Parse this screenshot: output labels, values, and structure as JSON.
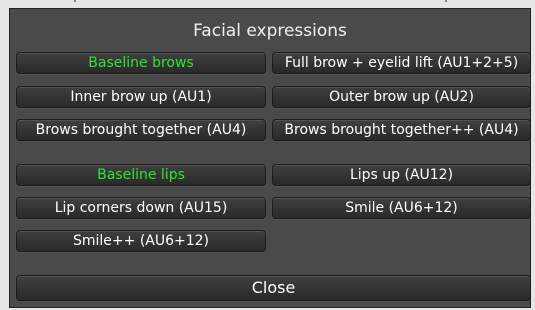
{
  "window": {
    "title": "Facial expressions"
  },
  "brows": {
    "baseline": "Baseline brows",
    "full_lift": "Full brow + eyelid lift (AU1+2+5)",
    "inner_up": "Inner brow up (AU1)",
    "outer_up": "Outer brow up (AU2)",
    "together": "Brows brought together (AU4)",
    "together_plus": "Brows brought together++ (AU4)"
  },
  "lips": {
    "baseline": "Baseline lips",
    "lips_up": "Lips up (AU12)",
    "corners_down": "Lip corners down (AU15)",
    "smile": "Smile (AU6+12)",
    "smile_plus": "Smile++ (AU6+12)"
  },
  "footer": {
    "close_label": "Close"
  },
  "colors": {
    "active_text": "#2ee62e",
    "panel_bg": "#4a4a4a",
    "button_text": "#ffffff"
  }
}
